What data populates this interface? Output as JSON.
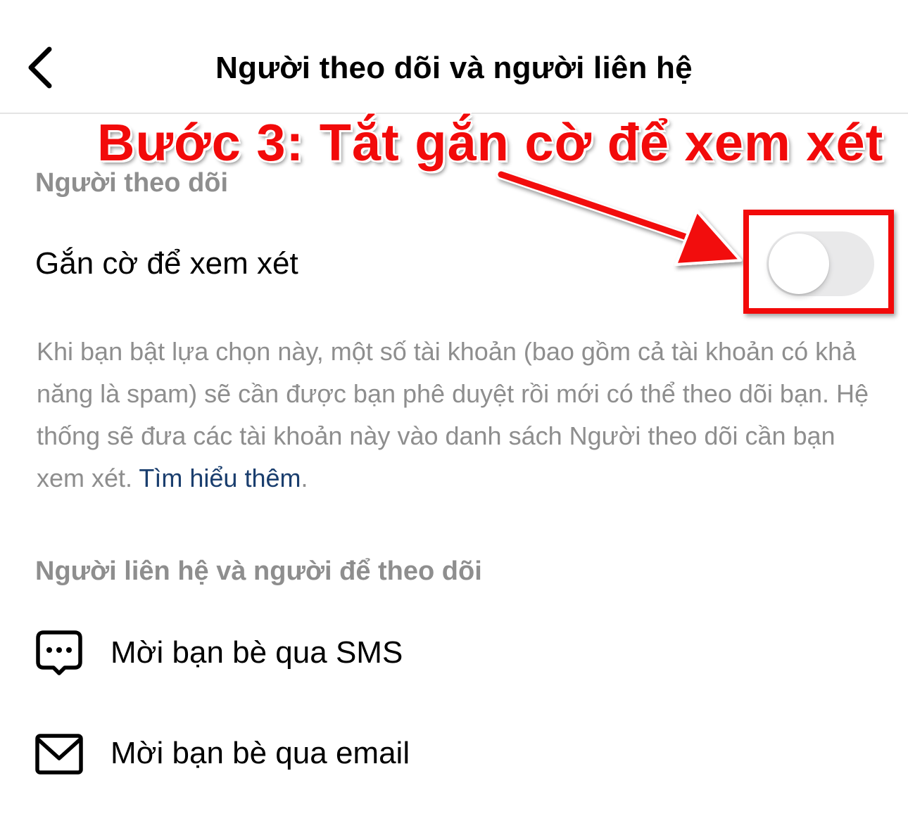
{
  "header": {
    "title": "Người theo dõi và người liên hệ",
    "back_icon": "chevron-left-icon"
  },
  "followers": {
    "heading": "Người theo dõi",
    "flag_label": "Gắn cờ để xem xét",
    "flag_toggle_on": false,
    "description": "Khi bạn bật lựa chọn này, một số tài khoản (bao gồm cả tài khoản có khả năng là spam) sẽ cần được bạn phê duyệt rồi mới có thể theo dõi bạn. Hệ thống sẽ đưa các tài khoản này vào danh sách Người theo dõi cần bạn xem xét. ",
    "learn_more": "Tìm hiểu thêm",
    "period": "."
  },
  "contacts": {
    "heading": "Người liên hệ và người để theo dõi",
    "items": [
      {
        "label": "Mời bạn bè qua SMS",
        "icon": "message-bubble-icon"
      },
      {
        "label": "Mời bạn bè qua email",
        "icon": "mail-icon"
      }
    ]
  },
  "annotation": {
    "text": "Bước 3: Tắt gắn cờ để xem xét",
    "color": "#f20a0a"
  },
  "colors": {
    "secondary_text": "#8e8e8e",
    "link": "#1a3e6e",
    "toggle_off_track": "#e9e9ea"
  }
}
